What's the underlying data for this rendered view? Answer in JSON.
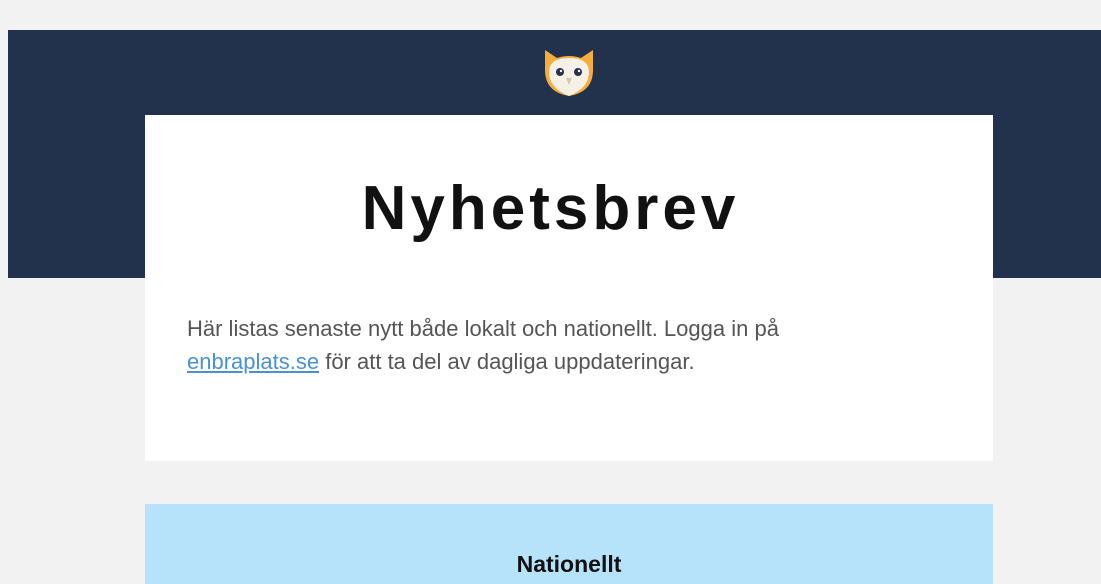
{
  "newsletter": {
    "logo_icon": "owl-icon",
    "title": "Nyhetsbrev",
    "intro_before": "Här listas senaste nytt både lokalt och nationellt. Logga in på",
    "intro_link": "enbraplats.se",
    "intro_after": " för att ta del av dagliga uppdateringar.",
    "section_title": "Nationellt"
  },
  "colors": {
    "header_band": "#22324d",
    "background": "#f2f2f3",
    "card": "#ffffff",
    "link": "#4a90d9",
    "section_band": "#b6e3fa",
    "owl_body": "#f6ad3c"
  }
}
